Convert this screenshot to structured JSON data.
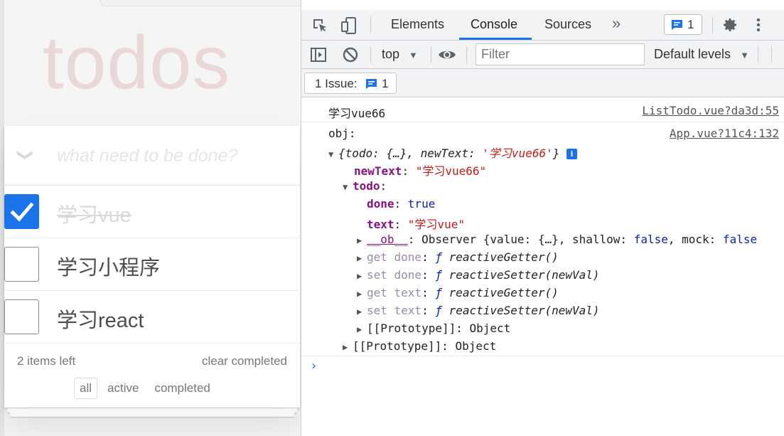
{
  "todo": {
    "title": "todos",
    "toggle_all_glyph": "❯",
    "input_placeholder": "what need to be done?",
    "items": [
      {
        "label": "学习vue",
        "done": true
      },
      {
        "label": "学习小程序",
        "done": false
      },
      {
        "label": "学习react",
        "done": false
      }
    ],
    "footer": {
      "count": "2 items left",
      "clear": "clear completed",
      "filters": [
        "all",
        "active",
        "completed"
      ],
      "selected_filter": "all"
    },
    "colors": {
      "title": "#af2f2f",
      "check": "#1a73e8"
    }
  },
  "devtools": {
    "tabs": [
      "Elements",
      "Console",
      "Sources"
    ],
    "active_tab": "Console",
    "more_tabs_glyph": "»",
    "messages_badge": "1",
    "toolbar": {
      "context": "top",
      "filter_placeholder": "Filter",
      "levels": "Default levels"
    },
    "issues": {
      "label": "1 Issue:",
      "count": "1"
    },
    "console": {
      "msg1": {
        "text": "学习vue66",
        "source": "ListTodo.vue?da3d:55"
      },
      "msg2": {
        "label": "obj:",
        "source": "App.vue?11c4:132",
        "summary_open": "{todo: {…}, newText: ",
        "summary_str": "'学习vue66'",
        "summary_close": "}",
        "info": "i",
        "newText_key": "newText",
        "newText_val": "\"学习vue66\"",
        "todo_key": "todo",
        "done_key": "done",
        "done_val": "true",
        "text_key": "text",
        "text_val": "\"学习vue\"",
        "ob_key": "__ob__",
        "ob_val_a": "Observer {value: {…}, shallow: ",
        "ob_false1": "false",
        "ob_val_b": ", mock: ",
        "ob_false2": "false",
        "get_done": "get done",
        "set_done": "set done",
        "get_text": "get text",
        "set_text": "set text",
        "f": "ƒ",
        "getter": "reactiveGetter()",
        "setter": "reactiveSetter(newVal)",
        "proto_key": "[[Prototype]]",
        "proto_val": "Object"
      },
      "prompt": "›"
    }
  }
}
